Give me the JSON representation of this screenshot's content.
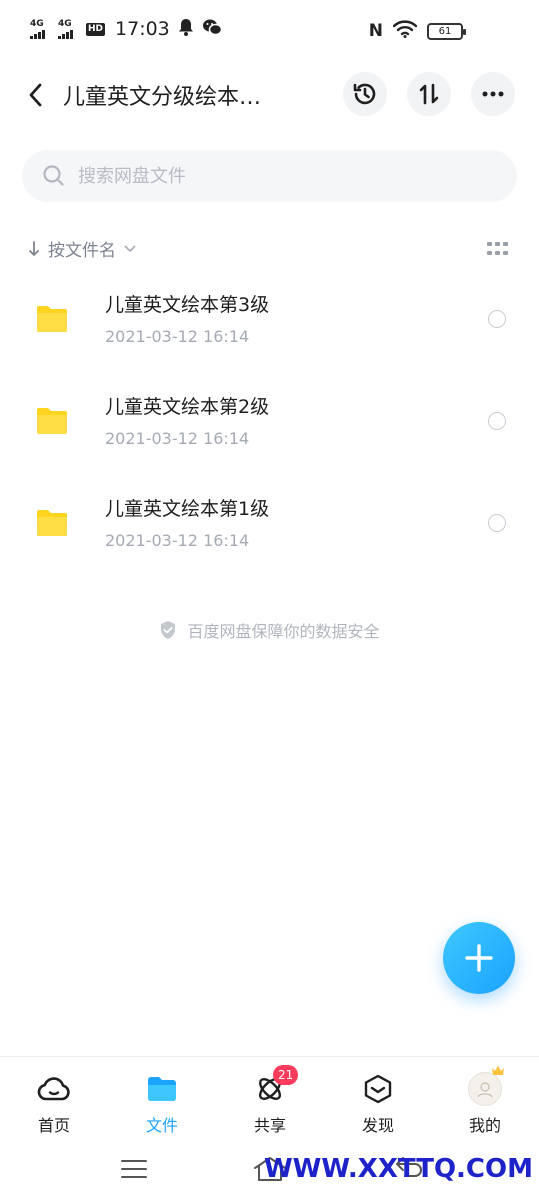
{
  "status_bar": {
    "sim1_tag": "4G",
    "sim2_tag": "4G",
    "hd_tag": "HD",
    "time": "17:03",
    "nfc": "N",
    "battery": "61"
  },
  "header": {
    "title": "儿童英文分级绘本…",
    "icons": [
      "back-icon",
      "history-icon",
      "sort-icon",
      "more-icon"
    ]
  },
  "search": {
    "placeholder": "搜索网盘文件"
  },
  "sort": {
    "label": "按文件名"
  },
  "files": [
    {
      "name": "儿童英文绘本第3级",
      "date": "2021-03-12  16:14"
    },
    {
      "name": "儿童英文绘本第2级",
      "date": "2021-03-12  16:14"
    },
    {
      "name": "儿童英文绘本第1级",
      "date": "2021-03-12  16:14"
    }
  ],
  "safety_note": "百度网盘保障你的数据安全",
  "tabs": [
    {
      "label": "首页",
      "icon": "cloud-icon"
    },
    {
      "label": "文件",
      "icon": "folder-icon",
      "active": true
    },
    {
      "label": "共享",
      "icon": "atom-icon",
      "badge": "21"
    },
    {
      "label": "发现",
      "icon": "box-icon"
    },
    {
      "label": "我的",
      "icon": "avatar"
    }
  ],
  "watermark": "WWW.XXTTQ.COM",
  "colors": {
    "accent": "#1aa3ff",
    "folder": "#ffd41f",
    "badge": "#ff3b5c",
    "watermark": "#1d22c9"
  }
}
